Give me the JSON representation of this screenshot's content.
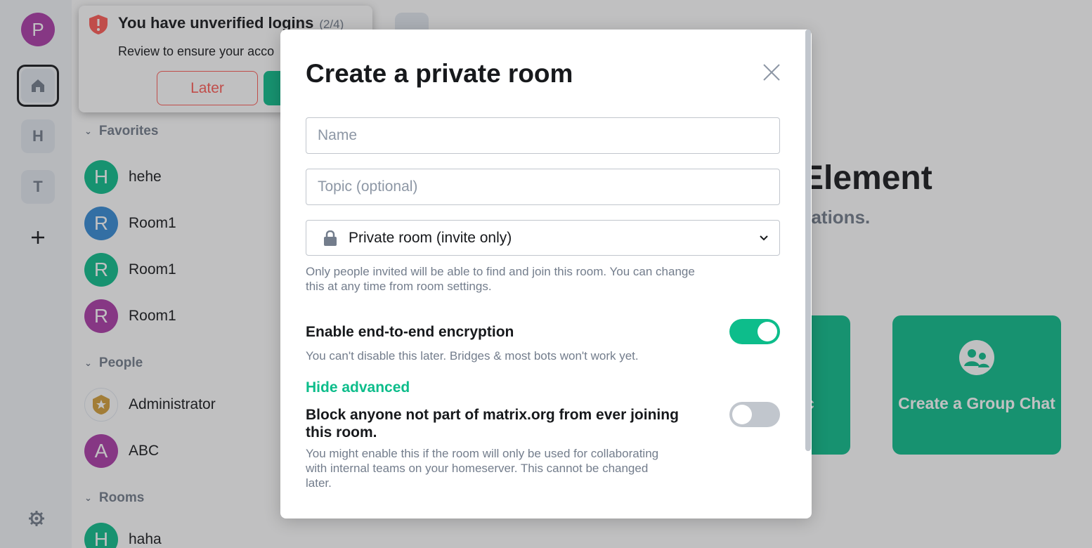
{
  "spaces": {
    "user_initial": "P",
    "items": [
      {
        "initial": "H"
      },
      {
        "initial": "T"
      }
    ],
    "add_label": "+"
  },
  "toast": {
    "title": "You have unverified logins",
    "count": "(2/4)",
    "body": "Review to ensure your acco",
    "later_label": "Later"
  },
  "room_list": {
    "favorites_header": "Favorites",
    "favorites": [
      {
        "initial": "H",
        "name": "hehe",
        "color": "#0dbd8b"
      },
      {
        "initial": "R",
        "name": "Room1",
        "color": "#368bd6"
      },
      {
        "initial": "R",
        "name": "Room1",
        "color": "#0dbd8b"
      },
      {
        "initial": "R",
        "name": "Room1",
        "color": "#ac3ba8"
      }
    ],
    "people_header": "People",
    "people": [
      {
        "initial": "",
        "name": "Administrator",
        "color": "#f4c371"
      },
      {
        "initial": "A",
        "name": "ABC",
        "color": "#ac3ba8"
      }
    ],
    "rooms_header": "Rooms",
    "rooms": [
      {
        "initial": "H",
        "name": "haha",
        "color": "#0dbd8b"
      }
    ]
  },
  "home": {
    "title_fragment": "Element",
    "subtitle_fragment": "sations.",
    "card1_fragment": "c",
    "card2_label": "Create a Group Chat"
  },
  "dialog": {
    "title": "Create a private room",
    "name_placeholder": "Name",
    "topic_placeholder": "Topic (optional)",
    "join_rule": "Private room (invite only)",
    "join_rule_desc": "Only people invited will be able to find and join this room. You can change this at any time from room settings.",
    "e2e_label": "Enable end-to-end encryption",
    "e2e_enabled": true,
    "e2e_desc": "You can't disable this later. Bridges & most bots won't work yet.",
    "advanced_toggle": "Hide advanced",
    "block_label": "Block anyone not part of matrix.org from ever joining this room.",
    "block_enabled": false,
    "block_desc": "You might enable this if the room will only be used for collaborating with internal teams on your homeserver. This cannot be changed later."
  },
  "colors": {
    "accent": "#0dbd8b",
    "user_avatar": "#ac3ba8",
    "alert": "#ff5b55"
  }
}
